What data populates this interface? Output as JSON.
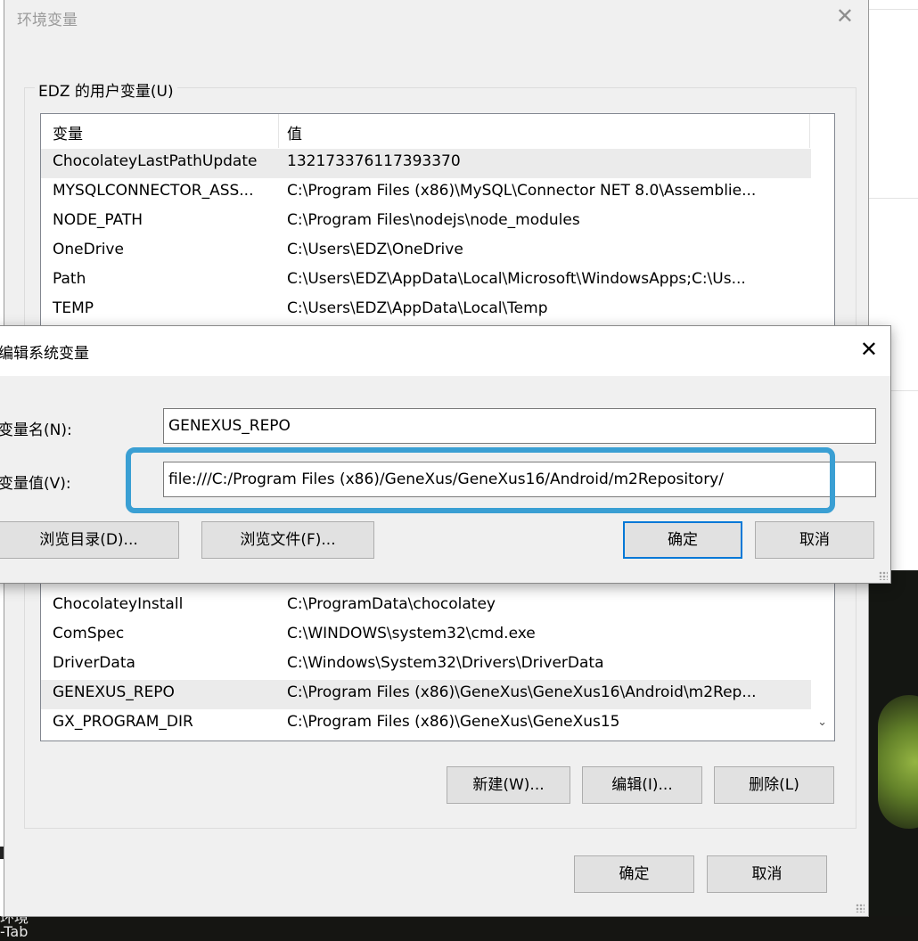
{
  "background": {
    "bottom_text_1": "环境",
    "bottom_text_2": "-Tab"
  },
  "env_window": {
    "title": "环境变量",
    "close_glyph": "✕",
    "user_group_label": "EDZ 的用户变量(U)",
    "columns": [
      "变量",
      "值"
    ],
    "user_vars": [
      {
        "name": "ChocolateyLastPathUpdate",
        "value": "132173376117393370"
      },
      {
        "name": "MYSQLCONNECTOR_ASS...",
        "value": "C:\\Program Files (x86)\\MySQL\\Connector NET 8.0\\Assemblie..."
      },
      {
        "name": "NODE_PATH",
        "value": "C:\\Program Files\\nodejs\\node_modules"
      },
      {
        "name": "OneDrive",
        "value": "C:\\Users\\EDZ\\OneDrive"
      },
      {
        "name": "Path",
        "value": "C:\\Users\\EDZ\\AppData\\Local\\Microsoft\\WindowsApps;C:\\Us..."
      },
      {
        "name": "TEMP",
        "value": "C:\\Users\\EDZ\\AppData\\Local\\Temp"
      }
    ],
    "system_vars": [
      {
        "name": "ChocolateyInstall",
        "value": "C:\\ProgramData\\chocolatey"
      },
      {
        "name": "ComSpec",
        "value": "C:\\WINDOWS\\system32\\cmd.exe"
      },
      {
        "name": "DriverData",
        "value": "C:\\Windows\\System32\\Drivers\\DriverData"
      },
      {
        "name": "GENEXUS_REPO",
        "value": "C:\\Program Files (x86)\\GeneXus\\GeneXus16\\Android\\m2Rep..."
      },
      {
        "name": "GX_PROGRAM_DIR",
        "value": "C:\\Program Files (x86)\\GeneXus\\GeneXus15"
      }
    ],
    "scroll_down_glyph": "⌄",
    "system_buttons": {
      "new": "新建(W)...",
      "edit": "编辑(I)...",
      "delete": "删除(L)"
    },
    "ok": "确定",
    "cancel": "取消"
  },
  "edit_dialog": {
    "title": "编辑系统变量",
    "close_glyph": "✕",
    "name_label": "变量名(N):",
    "name_value": "GENEXUS_REPO",
    "value_label": "变量值(V):",
    "value_value": "file:///C:/Program Files (x86)/GeneXus/GeneXus16/Android/m2Repository/",
    "browse_dir": "浏览目录(D)...",
    "browse_file": "浏览文件(F)...",
    "ok": "确定",
    "cancel": "取消",
    "highlight_color": "#3a9fd3"
  }
}
